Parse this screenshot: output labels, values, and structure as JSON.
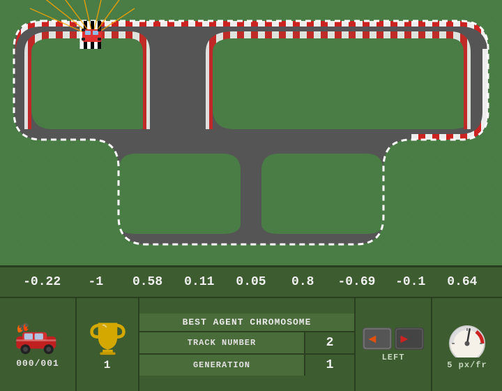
{
  "track": {
    "background_color": "#4a7c45"
  },
  "chromosome": {
    "values": [
      "-0.22",
      "-1",
      "0.58",
      "0.11",
      "0.05",
      "0.8",
      "-0.69",
      "-0.1",
      "0.64"
    ]
  },
  "best_agent_label": "BEST AGENT CHROMOSOME",
  "stats": {
    "lap_counter": "000/001",
    "lap_label": "000/001",
    "trophy_count": "1",
    "track_number_label": "TRACK NUMBER",
    "track_number_value": "2",
    "generation_label": "GENERATION",
    "generation_value": "1",
    "direction_label": "LEFT",
    "speed_label": "5 px/fr"
  },
  "sensor_rays": [
    {
      "angle": -65,
      "length": 110
    },
    {
      "angle": -50,
      "length": 95
    },
    {
      "angle": -35,
      "length": 80
    },
    {
      "angle": -20,
      "length": 70
    },
    {
      "angle": 0,
      "length": 65
    },
    {
      "angle": 20,
      "length": 75
    },
    {
      "angle": 35,
      "length": 90
    }
  ]
}
